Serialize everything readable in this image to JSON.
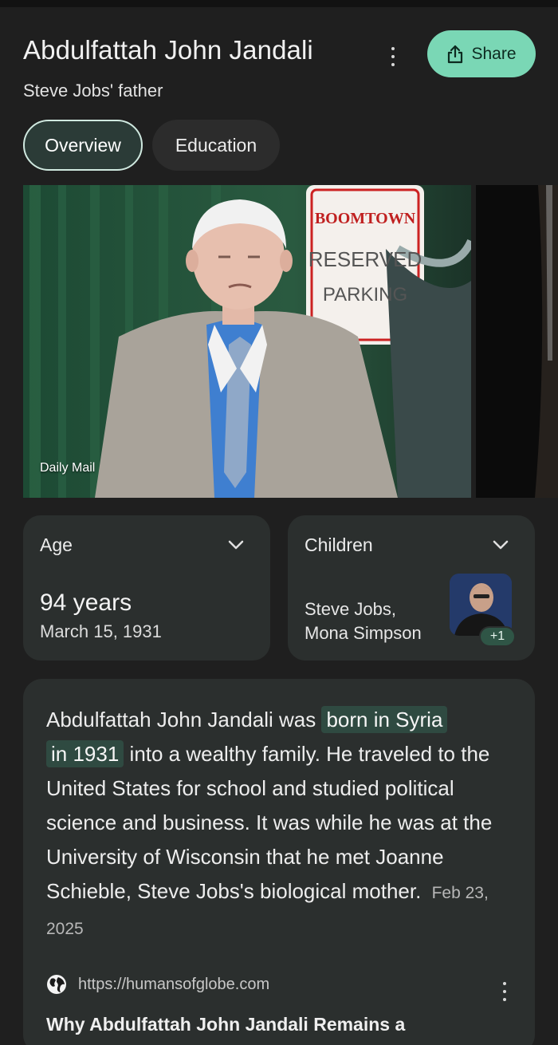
{
  "header": {
    "title": "Abdulfattah John Jandali",
    "subtitle": "Steve Jobs' father",
    "share_label": "Share",
    "more_icon": "more-vert-icon",
    "share_icon": "share-icon"
  },
  "tabs": [
    {
      "label": "Overview",
      "selected": true
    },
    {
      "label": "Education",
      "selected": false
    }
  ],
  "image": {
    "credit": "Daily Mail",
    "sign_lines": [
      "BOOMTOWN",
      "RESERVED",
      "PARKING"
    ]
  },
  "facts": {
    "age": {
      "label": "Age",
      "value": "94 years",
      "detail": "March 15, 1931"
    },
    "children": {
      "label": "Children",
      "line1": "Steve Jobs,",
      "line2": "Mona Simpson",
      "more_badge": "+1"
    }
  },
  "summary": {
    "pre": "Abdulfattah John Jandali was ",
    "highlight1": "born in Syria",
    "highlight2": "in 1931",
    "post": " into a wealthy family. He traveled to the United States for school and studied political science and business. It was while he was at the University of Wisconsin that he met Joanne Schieble, Steve Jobs's biological mother.",
    "date": "Feb 23, 2025",
    "source_url": "https://humansofglobe.com",
    "article_title": "Why Abdulfattah John Jandali Remains a"
  },
  "colors": {
    "background": "#1f1f1f",
    "card": "#2b2f2e",
    "accent": "#7ad7b5",
    "highlight": "#2f4a41"
  }
}
